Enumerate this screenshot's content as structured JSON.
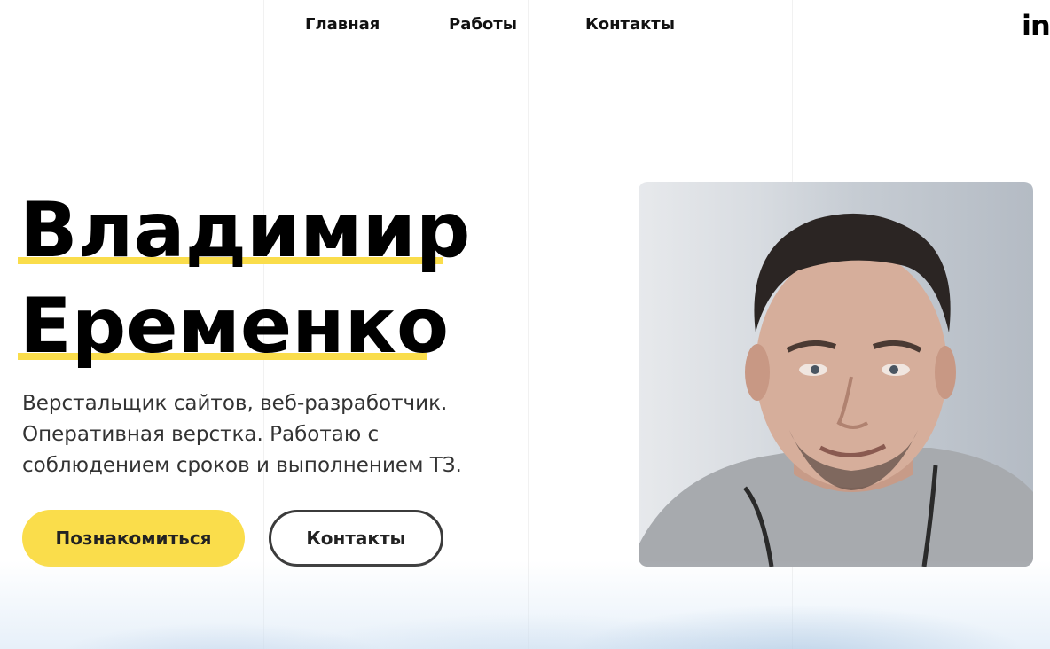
{
  "nav": {
    "items": [
      {
        "label": "Главная"
      },
      {
        "label": "Работы"
      },
      {
        "label": "Контакты"
      }
    ],
    "social": {
      "label": "in",
      "icon": "linkedin-icon"
    }
  },
  "hero": {
    "first_name": "Владимир",
    "last_name": "Еременко",
    "description_lines": [
      "Верстальщик сайтов, веб-разработчик.",
      "Оперативная верстка. Работаю с",
      "соблюдением сроков и выполнением ТЗ."
    ],
    "primary_button": "Познакомиться",
    "secondary_button": "Контакты",
    "photo_alt": "portrait-photo"
  },
  "colors": {
    "accent": "#fadd4b",
    "text": "#000000",
    "button_border": "#3b3b3b"
  }
}
